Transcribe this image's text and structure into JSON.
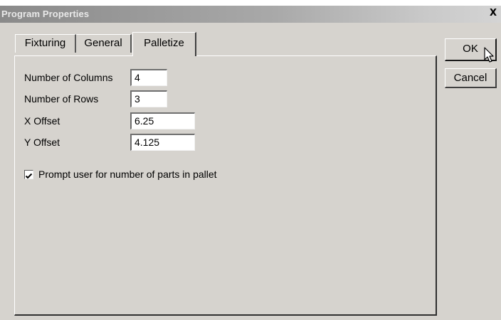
{
  "window": {
    "title": "Program Properties",
    "close_label": "X"
  },
  "tabs": [
    {
      "label": "Fixturing",
      "selected": false
    },
    {
      "label": "General",
      "selected": false
    },
    {
      "label": "Palletize",
      "selected": true
    }
  ],
  "palletize": {
    "columns": {
      "label": "Number of Columns",
      "value": "4"
    },
    "rows": {
      "label": "Number of Rows",
      "value": "3"
    },
    "x_offset": {
      "label": "X Offset",
      "value": "6.25"
    },
    "y_offset": {
      "label": "Y Offset",
      "value": "4.125"
    },
    "prompt_checkbox": {
      "label": "Prompt user for number of parts in pallet",
      "checked": true
    }
  },
  "buttons": {
    "ok": "OK",
    "cancel": "Cancel"
  },
  "colors": {
    "dialog_face": "#d6d3ce",
    "titlebar_inactive": "#a9a9a9"
  },
  "icons": {
    "close": "close-icon",
    "check": "checkmark-icon",
    "cursor": "mouse-pointer-icon"
  }
}
